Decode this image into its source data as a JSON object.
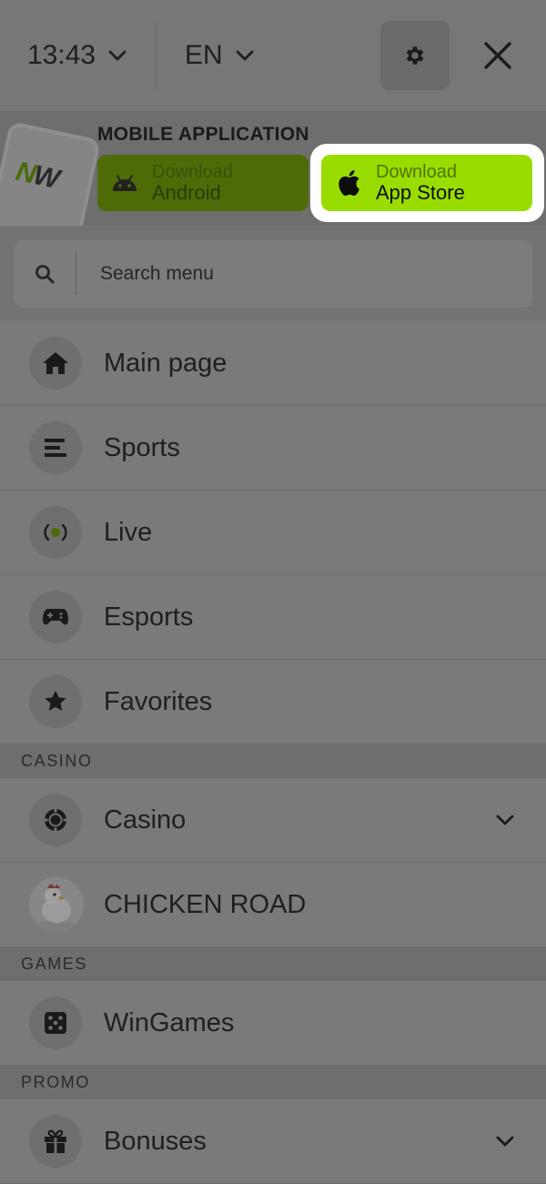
{
  "header": {
    "time": "13:43",
    "language": "EN",
    "settings_icon": "gear-icon",
    "close_icon": "close-icon"
  },
  "app_banner": {
    "title": "MOBILE APPLICATION",
    "android": {
      "line1": "Download",
      "line2": "Android",
      "icon": "android-icon"
    },
    "ios": {
      "line1": "Download",
      "line2": "App Store",
      "icon": "apple-icon"
    },
    "colors": {
      "android_button": "#4e6b08",
      "ios_button": "#99dd00",
      "highlight": "#ffffff"
    }
  },
  "search": {
    "placeholder": "Search menu"
  },
  "menu": {
    "main": [
      {
        "label": "Main page",
        "icon": "home-icon"
      },
      {
        "label": "Sports",
        "icon": "list-icon"
      },
      {
        "label": "Live",
        "icon": "live-icon"
      },
      {
        "label": "Esports",
        "icon": "gamepad-icon"
      },
      {
        "label": "Favorites",
        "icon": "star-icon"
      }
    ],
    "casino_section": "CASINO",
    "casino": [
      {
        "label": "Casino",
        "icon": "chip-icon",
        "expandable": true
      },
      {
        "label": "CHICKEN ROAD",
        "icon": "chicken-road-image"
      }
    ],
    "games_section": "GAMES",
    "games": [
      {
        "label": "WinGames",
        "icon": "dice-icon"
      }
    ],
    "promo_section": "PROMO",
    "promo": [
      {
        "label": "Bonuses",
        "icon": "gift-icon",
        "expandable": true
      }
    ]
  }
}
